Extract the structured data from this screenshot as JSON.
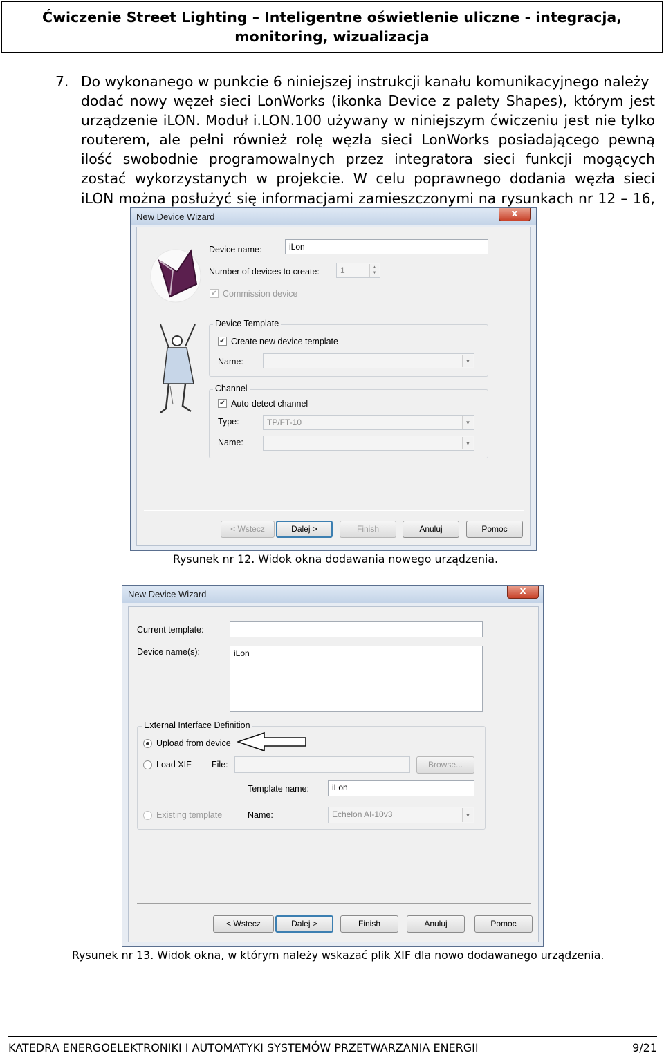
{
  "header": {
    "line1": "Ćwiczenie Street Lighting – Inteligentne oświetlenie uliczne - integracja,",
    "line2": "monitoring, wizualizacja"
  },
  "paragraph": {
    "number": "7.",
    "lines": [
      "Do wykonanego w punkcie 6 niniejszej instrukcji kanału komunikacyjnego należy",
      "dodać nowy węzeł sieci LonWorks (ikonka Device z palety Shapes), którym jest",
      "urządzenie iLON. Moduł i.LON.100 używany w niniejszym ćwiczeniu jest nie tylko",
      "routerem, ale pełni również rolę węzła sieci LonWorks posiadającego pewną",
      "ilość swobodnie programowalnych przez integratora sieci funkcji mogących",
      "zostać wykorzystanych w projekcie. W celu poprawnego dodania węzła sieci",
      "iLON można posłużyć się informacjami zamieszczonymi na rysunkach nr 12 – 16,"
    ]
  },
  "dialog1": {
    "title": "New Device Wizard",
    "close": "x",
    "device_name_label": "Device name:",
    "device_name_value": "iLon",
    "num_devices_label": "Number of devices to create:",
    "num_devices_value": "1",
    "commission_label": "Commission device",
    "template_group": "Device Template",
    "create_template_label": "Create new device template",
    "template_name_label": "Name:",
    "template_name_value": "",
    "channel_group": "Channel",
    "autodetect_label": "Auto-detect channel",
    "type_label": "Type:",
    "type_value": "TP/FT-10",
    "channel_name_label": "Name:",
    "channel_name_value": "",
    "buttons": {
      "back": "< Wstecz",
      "next": "Dalej >",
      "finish": "Finish",
      "cancel": "Anuluj",
      "help": "Pomoc"
    }
  },
  "caption1": "Rysunek nr 12. Widok okna dodawania nowego urządzenia.",
  "dialog2": {
    "title": "New Device Wizard",
    "close": "x",
    "current_template_label": "Current template:",
    "current_template_value": "",
    "device_names_label": "Device name(s):",
    "device_names_value": "iLon",
    "xif_group": "External Interface Definition",
    "upload_label": "Upload from device",
    "loadxif_label": "Load XIF",
    "file_label": "File:",
    "file_value": "",
    "browse": "Browse...",
    "template_name_label": "Template name:",
    "template_name_value": "iLon",
    "existing_label": "Existing template",
    "name_label": "Name:",
    "name_value": "Echelon AI-10v3",
    "buttons": {
      "back": "< Wstecz",
      "next": "Dalej >",
      "finish": "Finish",
      "cancel": "Anuluj",
      "help": "Pomoc"
    }
  },
  "caption2": "Rysunek nr 13. Widok okna, w którym należy wskazać plik XIF dla nowo dodawanego urządzenia.",
  "footer": {
    "text": "KATEDRA ENERGOELEKTRONIKI I AUTOMATYKI SYSTEMÓW PRZETWARZANIA ENERGII",
    "page": "9/21"
  }
}
